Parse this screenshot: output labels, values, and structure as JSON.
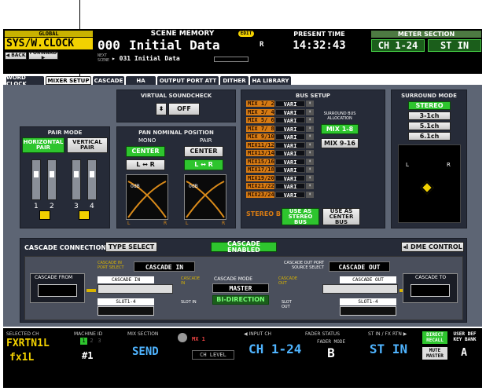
{
  "top": {
    "global_label": "GLOBAL",
    "global_value": "SYS/W.CLOCK",
    "back": "◀ BACK",
    "forward": "FORWARD ▶",
    "scene_memory_label": "SCENE MEMORY",
    "edit_badge": "EDIT",
    "scene_number": "000",
    "scene_name": "Initial Data",
    "r_indicator": "R",
    "next_label": "NEXT SCENE",
    "next_scene": "▸ 031 Initial Data",
    "present_time_label": "PRESENT TIME",
    "present_time": "14:32:43",
    "meter_section_label": "METER SECTION",
    "meter_left": "CH 1-24",
    "meter_right": "ST IN"
  },
  "tabs": [
    "WORD CLOCK",
    "MIXER SETUP",
    "CASCADE",
    "HA",
    "OUTPUT PORT ATT",
    "DITHER",
    "HA LIBRARY"
  ],
  "virtual_soundcheck": {
    "title": "VIRTUAL SOUNDCHECK",
    "value": "OFF"
  },
  "pair_mode": {
    "title": "PAIR MODE",
    "horizontal": "HORIZONTAL PAIR",
    "vertical": "VERTICAL PAIR",
    "channels": [
      "1",
      "2",
      "3",
      "4"
    ]
  },
  "pan_nominal": {
    "title": "PAN NOMINAL POSITION",
    "mono": "MONO",
    "pair": "PAIR",
    "center": "CENTER",
    "lr": "L ↔ R",
    "db": "0dB",
    "l": "L",
    "r": "R"
  },
  "bus_setup": {
    "title": "BUS SETUP",
    "rows": [
      {
        "name": "MIX 1/ 2",
        "value": "VARI"
      },
      {
        "name": "MIX 3/ 4",
        "value": "VARI"
      },
      {
        "name": "MIX 5/ 6",
        "value": "VARI"
      },
      {
        "name": "MIX 7/ 8",
        "value": "VARI"
      },
      {
        "name": "MIX 9/10",
        "value": "VARI"
      },
      {
        "name": "MIX11/12",
        "value": "VARI"
      },
      {
        "name": "MIX13/14",
        "value": "VARI"
      },
      {
        "name": "MIX15/16",
        "value": "VARI"
      },
      {
        "name": "MIX17/18",
        "value": "VARI"
      },
      {
        "name": "MIX19/20",
        "value": "VARI"
      },
      {
        "name": "MIX21/22",
        "value": "VARI"
      },
      {
        "name": "MIX23/24",
        "value": "VARI"
      }
    ],
    "surround_alloc": "SURROUND BUS ALLOCATION",
    "mix18": "MIX 1-8",
    "mix916": "MIX 9-16",
    "stereo_b": "STEREO B",
    "use_stereo": "USE AS STEREO BUS",
    "use_center": "USE AS CENTER BUS"
  },
  "surround_mode": {
    "title": "SURROUND MODE",
    "options": [
      "STEREO",
      "3-1ch",
      "5.1ch",
      "6.1ch"
    ],
    "l": "L",
    "r": "R"
  },
  "cascade": {
    "title": "CASCADE CONNECTION",
    "type_select": "TYPE SELECT",
    "enabled": "CASCADE ENABLED",
    "dme": "◂I DME CONTROL",
    "in_port_label": "CASCADE IN PORT SELECT",
    "in_port": "CASCADE IN",
    "out_port_label": "CASCADE OUT PORT SOURCE SELECT",
    "out_port": "CASCADE OUT",
    "from": "CASCADE FROM",
    "to": "CASCADE TO",
    "cascade_in": "CASCADE IN",
    "cascade_out": "CASCADE OUT",
    "slot_left": "SLOT1-4",
    "slot_right": "SLOT1-4",
    "center_in": "CASCADE IN",
    "center_out": "CASCADE OUT",
    "slot_in": "SLOT IN",
    "slot_out": "SLOT OUT",
    "mode_label": "CASCADE MODE",
    "mode": "MASTER",
    "bidir": "BI-DIRECTION"
  },
  "bottom": {
    "selected_ch_label": "SELECTED CH",
    "selected_ch": "FXRTN1L",
    "selected_sub": "fx1L",
    "machine_id_label": "MACHINE ID",
    "machine_id_digits": [
      "1",
      "2",
      "3"
    ],
    "machine_id": "#1",
    "mix_section_label": "MIX SECTION",
    "send": "SEND",
    "mix1": "MX 1",
    "ch_level": "CH LEVEL",
    "input_ch_label": "◀ INPUT CH",
    "fader_status_label": "FADER STATUS",
    "st_fx_label": "ST IN / FX RTN ▶",
    "input_ch": "CH 1-24",
    "fader_mode_label": "FADER MODE",
    "fader_mode": "B",
    "st_in": "ST IN",
    "direct_recall": "DIRECT RECALL",
    "mute_master": "MUTE MASTER",
    "user_def": "USER DEF KEY BANK",
    "bank": "A"
  }
}
